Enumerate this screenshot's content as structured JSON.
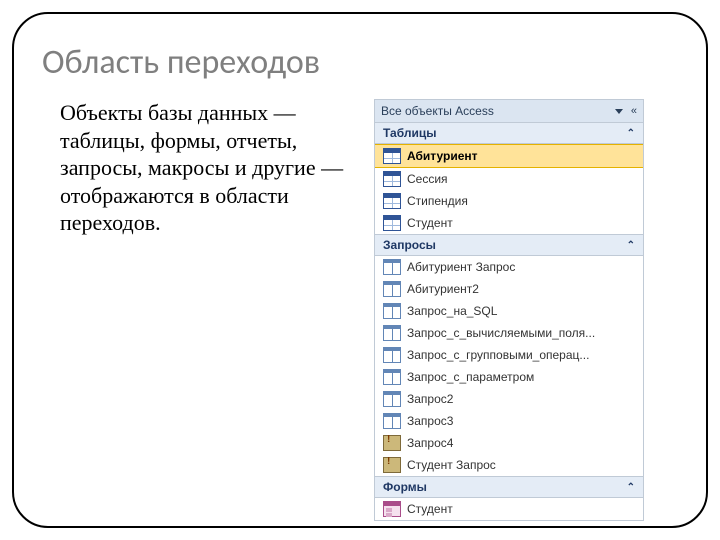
{
  "slide": {
    "title": "Область переходов",
    "body": "Объекты базы данных — таблицы, формы, отчеты, запросы, макросы и другие — отображаются в области переходов."
  },
  "nav_pane": {
    "header": {
      "title": "Все объекты Access",
      "collapse_symbol": "«"
    },
    "groups": [
      {
        "label": "Таблицы",
        "items": [
          {
            "icon": "table",
            "label": "Абитуриент",
            "selected": true
          },
          {
            "icon": "table",
            "label": "Сессия"
          },
          {
            "icon": "table",
            "label": "Стипендия"
          },
          {
            "icon": "table",
            "label": "Студент"
          }
        ]
      },
      {
        "label": "Запросы",
        "items": [
          {
            "icon": "query",
            "label": "Абитуриент Запрос"
          },
          {
            "icon": "query",
            "label": "Абитуриент2"
          },
          {
            "icon": "query",
            "label": "Запрос_на_SQL"
          },
          {
            "icon": "query",
            "label": "Запрос_с_вычисляемыми_поля..."
          },
          {
            "icon": "query",
            "label": "Запрос_с_групповыми_операц..."
          },
          {
            "icon": "query",
            "label": "Запрос_с_параметром"
          },
          {
            "icon": "query",
            "label": "Запрос2"
          },
          {
            "icon": "query",
            "label": "Запрос3"
          },
          {
            "icon": "query-action",
            "label": "Запрос4"
          },
          {
            "icon": "query-action",
            "label": "Студент Запрос"
          }
        ]
      },
      {
        "label": "Формы",
        "items": [
          {
            "icon": "form",
            "label": "Студент"
          }
        ]
      }
    ]
  }
}
